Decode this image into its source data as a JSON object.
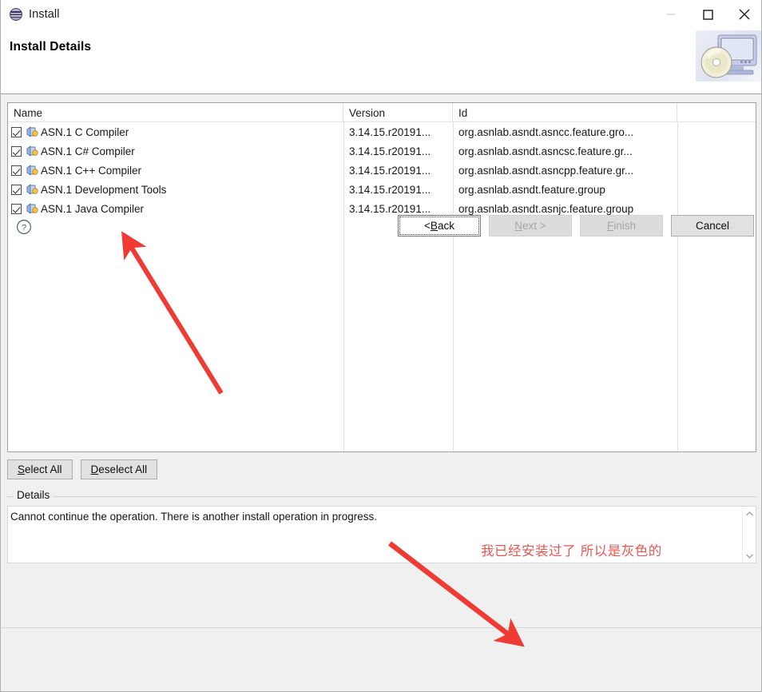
{
  "window": {
    "title": "Install",
    "icon": "eclipse-globe-icon",
    "controls": [
      {
        "name": "minimize-button",
        "glyph": "minimize-icon",
        "disabled": true
      },
      {
        "name": "maximize-button",
        "glyph": "maximize-icon",
        "disabled": false
      },
      {
        "name": "close-button",
        "glyph": "close-icon",
        "disabled": false
      }
    ]
  },
  "banner": {
    "page_title": "Install Details",
    "image": "monitor-with-cd-icon"
  },
  "table": {
    "columns": [
      {
        "key": "name",
        "label": "Name"
      },
      {
        "key": "version",
        "label": "Version"
      },
      {
        "key": "id",
        "label": "Id"
      },
      {
        "key": "extra",
        "label": ""
      }
    ],
    "rows": [
      {
        "checked": true,
        "icon": "feature-group-icon",
        "name": "ASN.1 C Compiler",
        "version": "3.14.15.r20191...",
        "id": "org.asnlab.asndt.asncc.feature.gro..."
      },
      {
        "checked": true,
        "icon": "feature-group-icon",
        "name": "ASN.1 C# Compiler",
        "version": "3.14.15.r20191...",
        "id": "org.asnlab.asndt.asncsc.feature.gr..."
      },
      {
        "checked": true,
        "icon": "feature-group-icon",
        "name": "ASN.1 C++ Compiler",
        "version": "3.14.15.r20191...",
        "id": "org.asnlab.asndt.asncpp.feature.gr..."
      },
      {
        "checked": true,
        "icon": "feature-group-icon",
        "name": "ASN.1 Development Tools",
        "version": "3.14.15.r20191...",
        "id": "org.asnlab.asndt.feature.group"
      },
      {
        "checked": true,
        "icon": "feature-group-icon",
        "name": "ASN.1 Java Compiler",
        "version": "3.14.15.r20191...",
        "id": "org.asnlab.asndt.asnjc.feature.group"
      }
    ]
  },
  "selection_buttons": {
    "select_all": {
      "prefix": "",
      "mnemonic": "S",
      "suffix": "elect All"
    },
    "deselect_all": {
      "prefix": "",
      "mnemonic": "D",
      "suffix": "eselect All"
    }
  },
  "details": {
    "legend": "Details",
    "message": "Cannot continue the operation.  There is another install operation in progress.",
    "scroll_up_icon": "chevron-up-icon",
    "scroll_down_icon": "chevron-down-icon"
  },
  "footer": {
    "help_icon": "help-question-icon",
    "buttons": [
      {
        "name": "back-button",
        "prefix": "< ",
        "mnemonic": "B",
        "suffix": "ack",
        "state": "focused"
      },
      {
        "name": "next-button",
        "prefix": "",
        "mnemonic": "N",
        "suffix": "ext >",
        "state": "disabled"
      },
      {
        "name": "finish-button",
        "prefix": "",
        "mnemonic": "F",
        "suffix": "inish",
        "state": "disabled"
      },
      {
        "name": "cancel-button",
        "prefix": "",
        "mnemonic": "",
        "suffix": "Cancel",
        "state": "normal"
      }
    ]
  },
  "annotations": {
    "chinese_note": "我已经安装过了 所以是灰色的",
    "note_color": "#e8564f",
    "arrow_color": "#ef3b34",
    "arrows": [
      {
        "name": "arrow-to-table",
        "from": [
          276,
          492
        ],
        "to": [
          154,
          296
        ]
      },
      {
        "name": "arrow-to-next-button",
        "from": [
          487,
          680
        ],
        "to": [
          650,
          806
        ]
      }
    ]
  }
}
